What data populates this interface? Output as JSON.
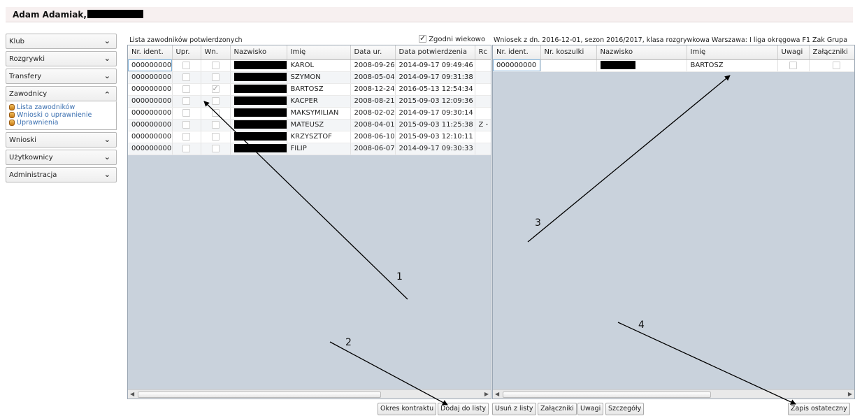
{
  "header": {
    "user_name": "Adam Adamiak,"
  },
  "sidebar": {
    "items": [
      {
        "label": "Klub",
        "chevron": "chevron-down-icon"
      },
      {
        "label": "Rozgrywki",
        "chevron": "chevron-down-icon"
      },
      {
        "label": "Transfery",
        "chevron": "chevron-down-icon"
      },
      {
        "label": "Zawodnicy",
        "chevron": "chevron-up-icon"
      },
      {
        "label": "Wnioski",
        "chevron": "chevron-down-icon"
      },
      {
        "label": "Użytkownicy",
        "chevron": "chevron-down-icon"
      },
      {
        "label": "Administracja",
        "chevron": "chevron-down-icon"
      }
    ],
    "submenu": [
      {
        "label": "Lista zawodników",
        "icon": "list-icon"
      },
      {
        "label": "Wnioski o uprawnienie",
        "icon": "request-icon"
      },
      {
        "label": "Uprawnienia",
        "icon": "permission-icon"
      }
    ]
  },
  "left_panel": {
    "title": "Lista zawodników potwierdzonych",
    "age_filter_label": "Zgodni wiekowo",
    "age_filter_checked": true,
    "columns": [
      "Nr. ident.",
      "Upr.",
      "Wn.",
      "Nazwisko",
      "Imię",
      "Data ur.",
      "Data potwierdzenia",
      "Rc"
    ],
    "rows": [
      {
        "id": "000000000",
        "upr": false,
        "wn": false,
        "first_name": "KAROL",
        "birth": "2008-09-26",
        "confirmed": "2014-09-17 09:49:46",
        "rc": ""
      },
      {
        "id": "000000000",
        "upr": false,
        "wn": false,
        "first_name": "SZYMON",
        "birth": "2008-05-04",
        "confirmed": "2014-09-17 09:31:38",
        "rc": ""
      },
      {
        "id": "000000000",
        "upr": false,
        "wn": true,
        "first_name": "BARTOSZ",
        "birth": "2008-12-24",
        "confirmed": "2016-05-13 12:54:34",
        "rc": ""
      },
      {
        "id": "000000000",
        "upr": false,
        "wn": false,
        "first_name": "KACPER",
        "birth": "2008-08-21",
        "confirmed": "2015-09-03 12:09:36",
        "rc": ""
      },
      {
        "id": "000000000",
        "upr": false,
        "wn": false,
        "first_name": "MAKSYMILIAN",
        "birth": "2008-02-02",
        "confirmed": "2014-09-17 09:30:14",
        "rc": ""
      },
      {
        "id": "000000000",
        "upr": false,
        "wn": false,
        "first_name": "MATEUSZ",
        "birth": "2008-04-01",
        "confirmed": "2015-09-03 11:25:38",
        "rc": "Z -"
      },
      {
        "id": "000000000",
        "upr": false,
        "wn": false,
        "first_name": "KRZYSZTOF",
        "birth": "2008-06-10",
        "confirmed": "2015-09-03 12:10:11",
        "rc": ""
      },
      {
        "id": "000000000",
        "upr": false,
        "wn": false,
        "first_name": "FILIP",
        "birth": "2008-06-07",
        "confirmed": "2014-09-17 09:30:33",
        "rc": ""
      }
    ]
  },
  "right_panel": {
    "title": "Wniosek z dn. 2016-12-01, sezon 2016/2017, klasa rozgrywkowa Warszawa: I liga okręgowa F1 Żak Grupa",
    "columns": [
      "Nr. ident.",
      "Nr. koszulki",
      "Nazwisko",
      "Imię",
      "Uwagi",
      "Załączniki"
    ],
    "rows": [
      {
        "id": "000000000",
        "shirt": "",
        "first_name": "BARTOSZ",
        "uwagi": false,
        "zal": false
      }
    ]
  },
  "buttons": {
    "okres": "Okres kontraktu",
    "dodaj": "Dodaj do listy",
    "usun": "Usuń z listy",
    "zalaczniki": "Załączniki",
    "uwagi": "Uwagi",
    "szczegoly": "Szczegóły",
    "zapis": "Zapis ostateczny"
  },
  "annotations": [
    "1",
    "2",
    "3",
    "4"
  ]
}
